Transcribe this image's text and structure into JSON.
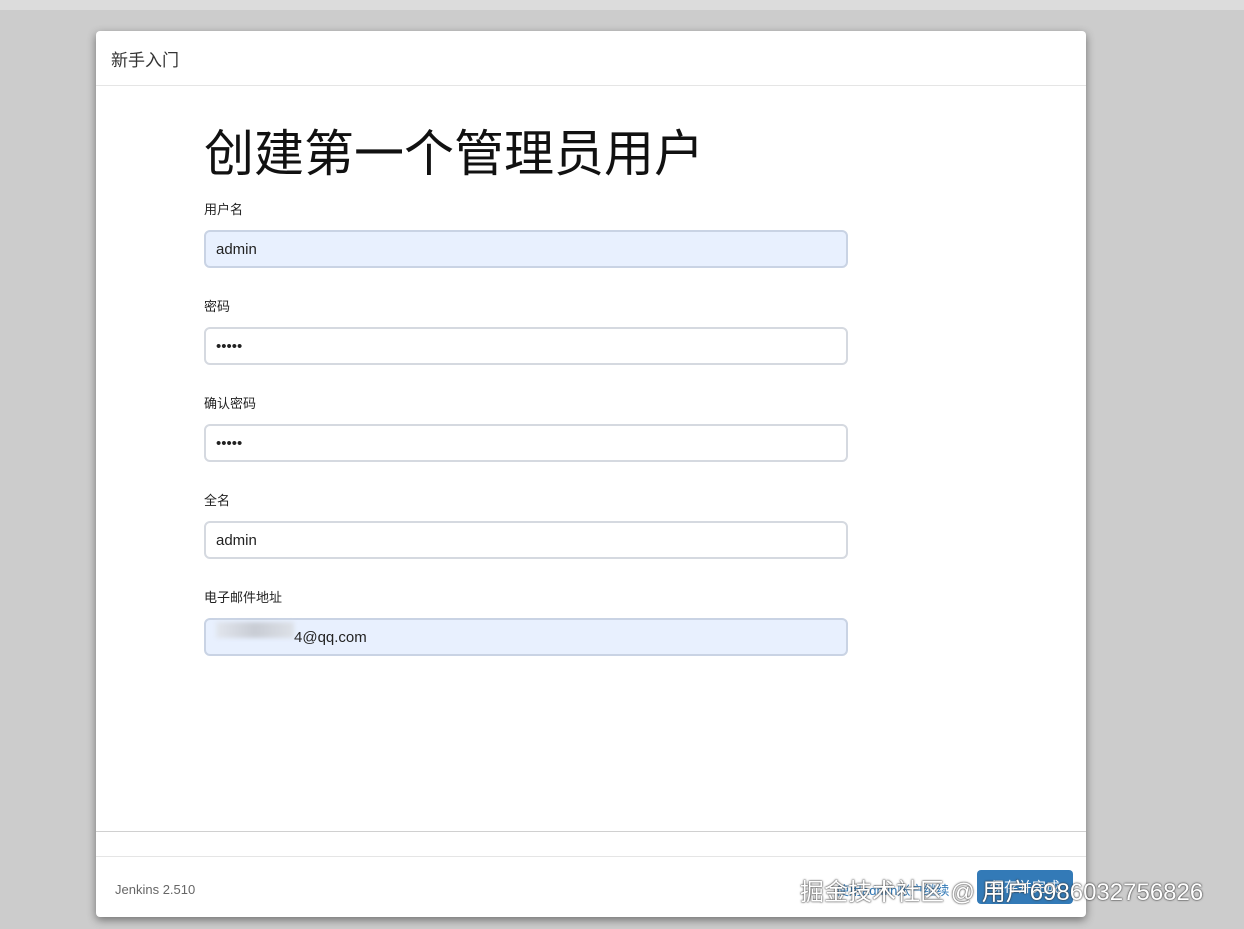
{
  "dialog": {
    "title": "新手入门"
  },
  "form": {
    "heading": "创建第一个管理员用户",
    "fields": [
      {
        "label": "用户名",
        "value": "admin"
      },
      {
        "label": "密码",
        "value": "•••••"
      },
      {
        "label": "确认密码",
        "value": "•••••"
      },
      {
        "label": "全名",
        "value": "admin"
      },
      {
        "label": "电子邮件地址",
        "value": "4@qq.com"
      }
    ]
  },
  "footer": {
    "version": "Jenkins 2.510",
    "skip_link": "使用admin账户继续",
    "save_button": "保存并完成"
  },
  "watermark": "掘金技术社区 @ 用户6986032756826"
}
